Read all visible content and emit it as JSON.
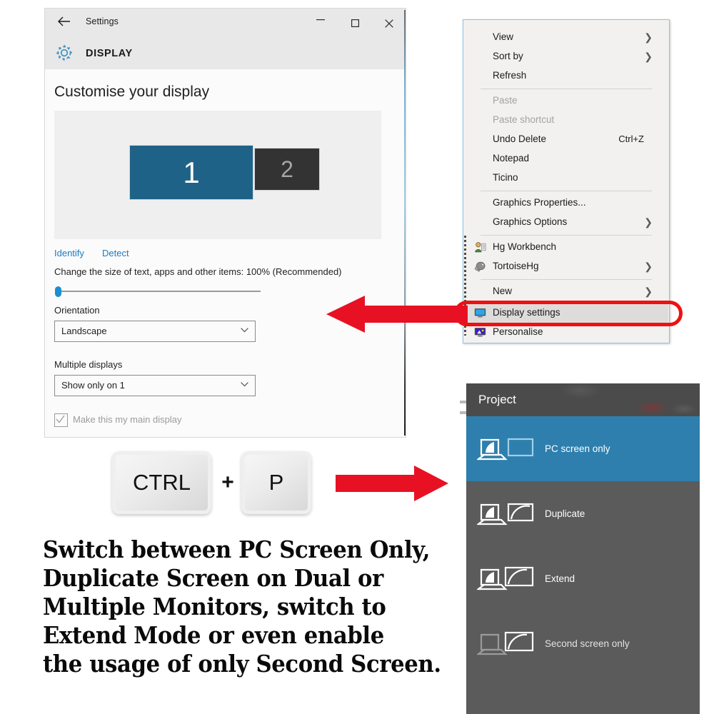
{
  "settings_window": {
    "title": "Settings",
    "back_icon": "back-arrow-icon",
    "section_icon": "gear-icon",
    "section_label": "DISPLAY",
    "window_controls": {
      "minimize": "minimize-icon",
      "maximize": "maximize-icon",
      "close": "close-icon"
    },
    "heading": "Customise your display",
    "monitors": [
      {
        "number": "1",
        "state": "selected",
        "color": "#1f6287"
      },
      {
        "number": "2",
        "state": "inactive",
        "color": "#333333"
      }
    ],
    "links": {
      "identify": "Identify",
      "detect": "Detect"
    },
    "scale_label": "Change the size of text, apps and other items: 100% (Recommended)",
    "scale_percent": 100,
    "slider_position_percent": 0,
    "orientation": {
      "label": "Orientation",
      "value": "Landscape",
      "chevron": "chevron-down-icon"
    },
    "multiple_displays": {
      "label": "Multiple displays",
      "value": "Show only on 1",
      "chevron": "chevron-down-icon"
    },
    "main_display_checkbox": {
      "label": "Make this my main display",
      "checked": true,
      "disabled": true
    }
  },
  "context_menu": {
    "items": [
      {
        "label": "View",
        "submenu": true,
        "disabled": false,
        "accel": "",
        "icon": ""
      },
      {
        "label": "Sort by",
        "submenu": true,
        "disabled": false,
        "accel": "",
        "icon": ""
      },
      {
        "label": "Refresh",
        "submenu": false,
        "disabled": false,
        "accel": "",
        "icon": ""
      },
      {
        "label": "Paste",
        "submenu": false,
        "disabled": true,
        "accel": "",
        "icon": ""
      },
      {
        "label": "Paste shortcut",
        "submenu": false,
        "disabled": true,
        "accel": "",
        "icon": ""
      },
      {
        "label": "Undo Delete",
        "submenu": false,
        "disabled": false,
        "accel": "Ctrl+Z",
        "icon": ""
      },
      {
        "label": "Notepad",
        "submenu": false,
        "disabled": false,
        "accel": "",
        "icon": ""
      },
      {
        "label": "Ticino",
        "submenu": false,
        "disabled": false,
        "accel": "",
        "icon": ""
      },
      {
        "label": "Graphics Properties...",
        "submenu": false,
        "disabled": false,
        "accel": "",
        "icon": ""
      },
      {
        "label": "Graphics Options",
        "submenu": true,
        "disabled": false,
        "accel": "",
        "icon": ""
      },
      {
        "label": "Hg Workbench",
        "submenu": false,
        "disabled": false,
        "accel": "",
        "icon": "hg-workbench-icon"
      },
      {
        "label": "TortoiseHg",
        "submenu": true,
        "disabled": false,
        "accel": "",
        "icon": "tortoisehg-icon"
      },
      {
        "label": "New",
        "submenu": true,
        "disabled": false,
        "accel": "",
        "icon": ""
      },
      {
        "label": "Display settings",
        "submenu": false,
        "disabled": false,
        "accel": "",
        "icon": "display-settings-icon",
        "highlighted": true
      },
      {
        "label": "Personalise",
        "submenu": false,
        "disabled": false,
        "accel": "",
        "icon": "personalise-icon"
      }
    ],
    "highlight_color": "#ee1111"
  },
  "shortcut": {
    "key1": "CTRL",
    "plus": "+",
    "key2": "P"
  },
  "arrows": {
    "left_arrow": "arrow-left-icon",
    "right_arrow": "arrow-right-icon",
    "color": "#e81123"
  },
  "caption": {
    "line1": "Switch between PC Screen Only,",
    "line2": "Duplicate Screen on Dual or",
    "line3": "Multiple Monitors, switch to",
    "line4": "Extend Mode or even enable",
    "line5": "the usage of only Second Screen."
  },
  "project_panel": {
    "title": "Project",
    "selected_color": "#2e7fad",
    "options": [
      {
        "label": "PC screen only",
        "icon": "pc-screen-only-icon",
        "selected": true
      },
      {
        "label": "Duplicate",
        "icon": "duplicate-icon",
        "selected": false
      },
      {
        "label": "Extend",
        "icon": "extend-icon",
        "selected": false
      },
      {
        "label": "Second screen only",
        "icon": "second-screen-only-icon",
        "selected": false
      }
    ]
  }
}
